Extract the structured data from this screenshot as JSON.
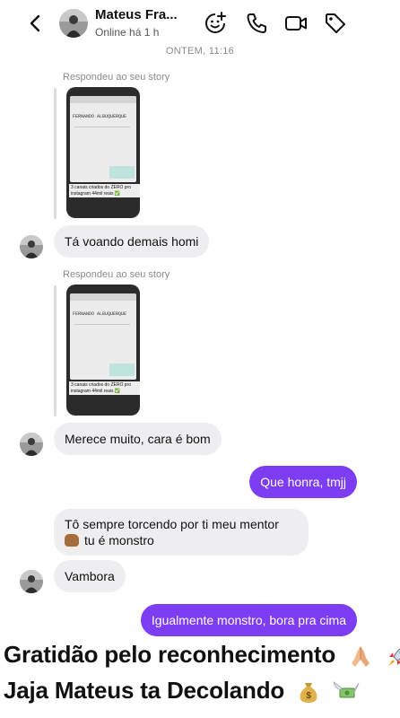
{
  "header": {
    "name": "Mateus Fra...",
    "status": "Online há 1 h",
    "icons": [
      "back-icon",
      "sticker-add-icon",
      "phone-icon",
      "video-icon",
      "tag-icon"
    ]
  },
  "thread": {
    "time_separator": "ONTEM, 11:16",
    "story_replies": [
      {
        "label": "Respondeu ao seu story",
        "thumb_title": "FERNANDO  ALBUQUERQUE",
        "thumb_caption": "3 canais criados do ZERO pro instagram 44mil reais ✅"
      },
      {
        "label": "Respondeu ao seu story",
        "thumb_title": "FERNANDO  ALBUQUERQUE",
        "thumb_caption": "3 canais criados do ZERO pro instagram 44mil reais ✅"
      }
    ],
    "messages": [
      {
        "text": "Tá voando demais homi"
      },
      {
        "text": "Merece muito, cara é bom"
      },
      {
        "text": "Que honra, tmjj"
      },
      {
        "text_line1": "Tô sempre torcendo por ti meu mentor",
        "text_line2": "tu é monstro"
      },
      {
        "text": "Vambora"
      },
      {
        "text": "Igualmente monstro, bora pra cima"
      }
    ]
  },
  "overlay": {
    "line1": "Gratidão pelo reconhecimento",
    "line2": "Jaja Mateus ta Decolando"
  },
  "colors": {
    "outgoing_bubble": "#7d3df2",
    "incoming_bubble": "#eeeef0"
  }
}
